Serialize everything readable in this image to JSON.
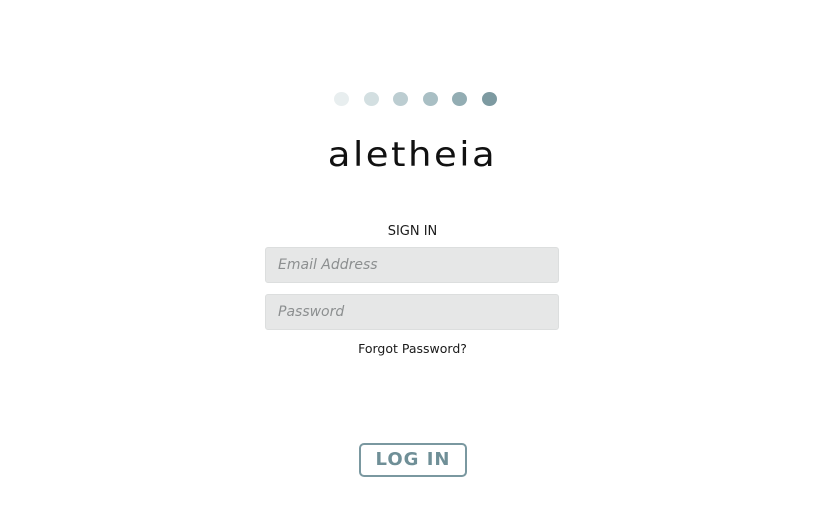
{
  "logo": {
    "dots": [
      {
        "color": "#e8eeef"
      },
      {
        "color": "#d3dfe1"
      },
      {
        "color": "#bccdd1"
      },
      {
        "color": "#a9bfc4"
      },
      {
        "color": "#93adb3"
      },
      {
        "color": "#7d9aa1"
      }
    ],
    "name": "aletheia"
  },
  "signin": {
    "title": "SIGN IN",
    "email_placeholder": "Email Address",
    "email_value": "",
    "password_placeholder": "Password",
    "password_value": "",
    "forgot_label": "Forgot Password?",
    "login_label": "LOG IN"
  },
  "colors": {
    "accent": "#7a98a0",
    "field_bg": "#e6e7e7"
  }
}
